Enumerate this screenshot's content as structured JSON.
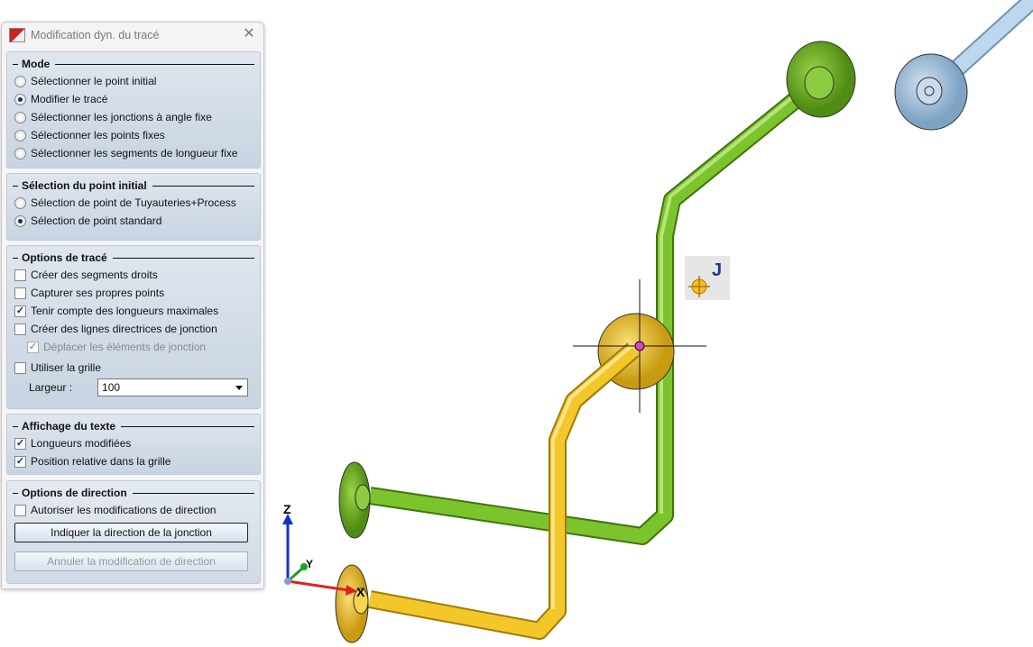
{
  "dialog": {
    "title": "Modification dyn. du tracé",
    "mode": {
      "legend": "Mode",
      "options": [
        {
          "label": "Sélectionner le point initial",
          "checked": false
        },
        {
          "label": "Modifier le tracé",
          "checked": true
        },
        {
          "label": "Sélectionner les jonctions à angle fixe",
          "checked": false
        },
        {
          "label": "Sélectionner les points fixes",
          "checked": false
        },
        {
          "label": "Sélectionner les segments de longueur fixe",
          "checked": false
        }
      ]
    },
    "initial_point": {
      "legend": "Sélection du point initial",
      "options": [
        {
          "label": "Sélection de point de Tuyauteries+Process",
          "checked": false
        },
        {
          "label": "Sélection de point standard",
          "checked": true
        }
      ]
    },
    "trace_options": {
      "legend": "Options de tracé",
      "checks": [
        {
          "label": "Créer des segments droits",
          "checked": false
        },
        {
          "label": "Capturer ses propres points",
          "checked": false
        },
        {
          "label": "Tenir compte des longueurs maximales",
          "checked": true
        },
        {
          "label": "Créer des lignes directrices de jonction",
          "checked": false
        }
      ],
      "sub_check": {
        "label": "Déplacer les éléments de jonction",
        "checked": true,
        "disabled": true
      },
      "grid_check": {
        "label": "Utiliser la grille",
        "checked": false
      },
      "width_label": "Largeur :",
      "width_value": "100"
    },
    "text_display": {
      "legend": "Affichage du texte",
      "checks": [
        {
          "label": "Longueurs modifiées",
          "checked": true
        },
        {
          "label": "Position relative dans la grille",
          "checked": true
        }
      ]
    },
    "direction": {
      "legend": "Options de direction",
      "check": {
        "label": "Autoriser les modifications de direction",
        "checked": false
      },
      "indicate_button": "Indiquer la direction de la jonction",
      "cancel_button": "Annuler la modification de direction"
    }
  },
  "viewport": {
    "snap_label": "J",
    "axes": {
      "x": "X",
      "y": "Y",
      "z": "Z"
    },
    "colors": {
      "green": "#6ab41e",
      "yellow": "#f0c020",
      "blue": "#a8c8e4"
    }
  }
}
